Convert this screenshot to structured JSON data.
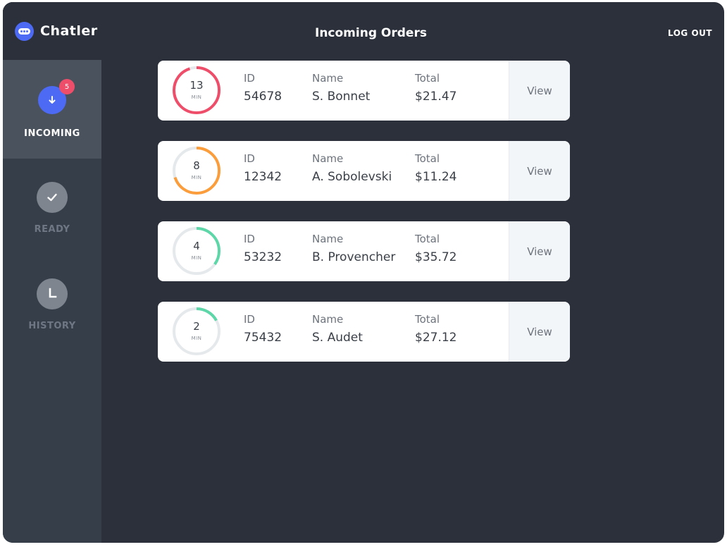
{
  "brand": {
    "name": "Chatler",
    "accent": "#4d6af5"
  },
  "sidebar": {
    "items": [
      {
        "label": "INCOMING",
        "icon": "arrow-down-icon",
        "badge": "5",
        "active": true
      },
      {
        "label": "READY",
        "icon": "check-icon",
        "active": false
      },
      {
        "label": "HISTORY",
        "icon": "clock-icon",
        "active": false
      }
    ]
  },
  "header": {
    "title": "Incoming Orders",
    "logout_label": "LOG OUT"
  },
  "columns": {
    "id": "ID",
    "name": "Name",
    "total": "Total"
  },
  "orders": [
    {
      "minutes": "13",
      "unit": "MIN",
      "id": "54678",
      "name": "S. Bonnet",
      "total": "$21.47",
      "view_label": "View",
      "progress": 0.95,
      "color": "#ef4e6a"
    },
    {
      "minutes": "8",
      "unit": "MIN",
      "id": "12342",
      "name": "A. Sobolevski",
      "total": "$11.24",
      "view_label": "View",
      "progress": 0.7,
      "color": "#fb9d3b"
    },
    {
      "minutes": "4",
      "unit": "MIN",
      "id": "53232",
      "name": "B. Provencher",
      "total": "$35.72",
      "view_label": "View",
      "progress": 0.35,
      "color": "#5dd6a8"
    },
    {
      "minutes": "2",
      "unit": "MIN",
      "id": "75432",
      "name": "S. Audet",
      "total": "$27.12",
      "view_label": "View",
      "progress": 0.17,
      "color": "#5dd6a8"
    }
  ]
}
